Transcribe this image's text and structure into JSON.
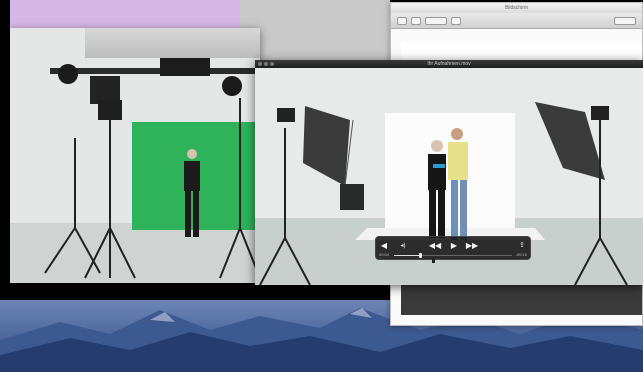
{
  "player": {
    "title": "Ihr Aufnahmen.mov",
    "controls": {
      "volume_icon": "speaker-icon",
      "rewind_icon": "rewind-icon",
      "play_icon": "play-icon",
      "forward_icon": "fast-forward-icon",
      "share_icon": "share-icon",
      "fullscreen_icon": "fullscreen-icon"
    },
    "time_elapsed": "00:04",
    "time_remaining": "-00:15",
    "progress": 0.22
  },
  "preview": {
    "title": "Bildschirm"
  },
  "colors": {
    "green_screen": "#2fb35a",
    "wallpaper_sky": "#3f5f9c",
    "desktop_purple": "#d7b7e6",
    "controller_bg": "#161616"
  }
}
